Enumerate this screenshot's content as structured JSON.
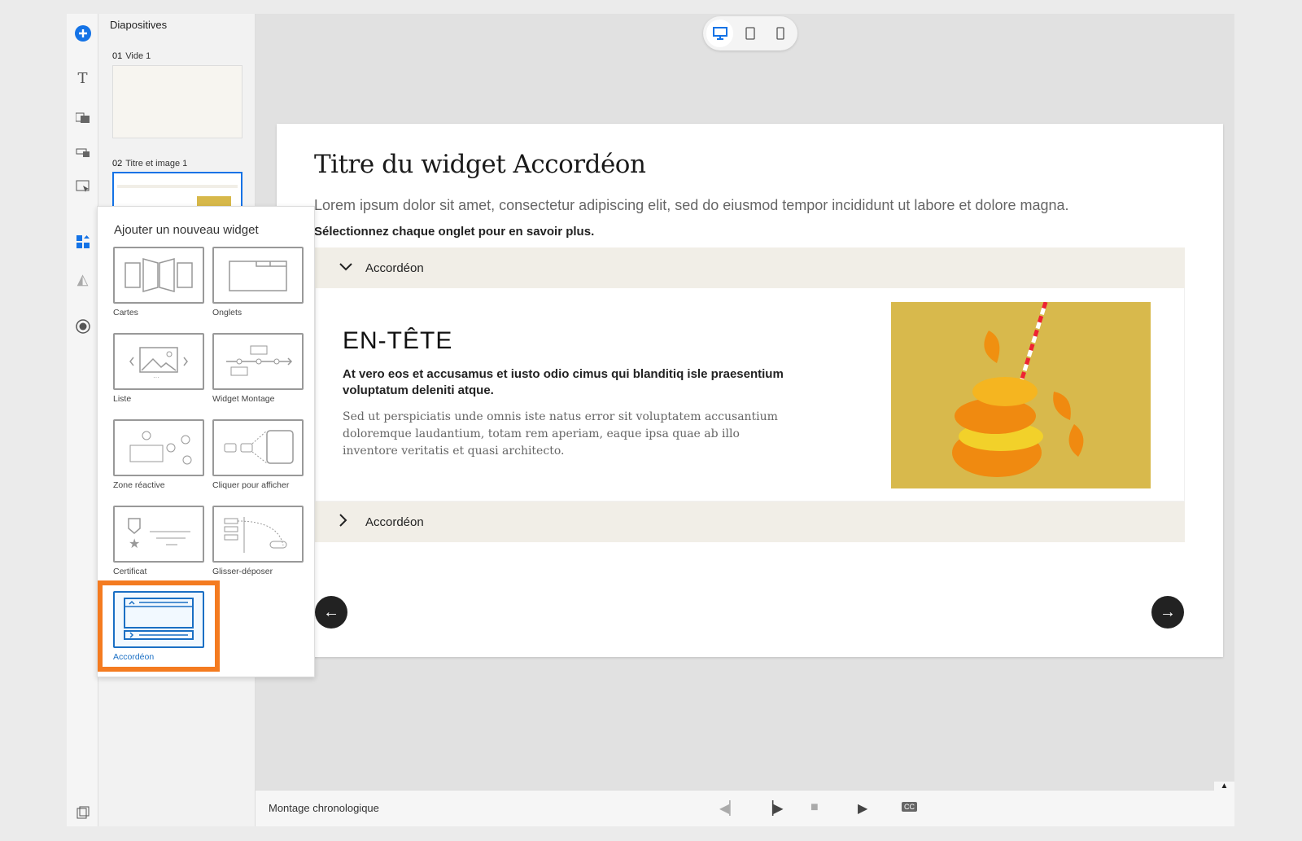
{
  "toolbar": {
    "icons": [
      "add-icon",
      "text-icon",
      "media-icon",
      "interaction-icon",
      "widget-card-icon",
      "widgets-icon",
      "shapes-icon",
      "record-icon",
      "panel-icon"
    ]
  },
  "slides_panel": {
    "title": "Diapositives",
    "slides": [
      {
        "number": "01",
        "name": "Vide 1"
      },
      {
        "number": "02",
        "name": "Titre et image 1"
      }
    ]
  },
  "device_toggle": {
    "options": [
      "desktop",
      "tablet",
      "mobile"
    ],
    "selected": "desktop"
  },
  "slide": {
    "title": "Titre du widget Accordéon",
    "lead": "Lorem ipsum dolor sit amet, consectetur adipiscing elit, sed do eiusmod tempor incididunt ut labore et dolore magna.",
    "instruction": "Sélectionnez chaque onglet pour en savoir plus.",
    "accordions": [
      {
        "label": "Accordéon",
        "expanded": true
      },
      {
        "label": "Accordéon",
        "expanded": false
      }
    ],
    "panel": {
      "heading": "EN-TÊTE",
      "bold": "At vero eos et accusamus et iusto odio cimus qui blanditiq isle praesentium voluptatum deleniti atque.",
      "body": "Sed ut perspiciatis unde omnis iste natus error sit voluptatem accusantium doloremque laudantium, totam rem aperiam, eaque ipsa quae ab illo inventore veritatis et quasi architecto."
    }
  },
  "popup": {
    "title": "Ajouter un nouveau widget",
    "widgets": [
      "Cartes",
      "Onglets",
      "Liste",
      "Widget Montage",
      "Zone réactive",
      "Cliquer pour afficher",
      "Certificat",
      "Glisser-déposer",
      "Accordéon"
    ],
    "selected": "Accordéon"
  },
  "timeline": {
    "label": "Montage chronologique"
  },
  "colors": {
    "accent": "#1a6fc4",
    "highlight": "#f47b20",
    "accordion_bg": "#f1eee7"
  }
}
